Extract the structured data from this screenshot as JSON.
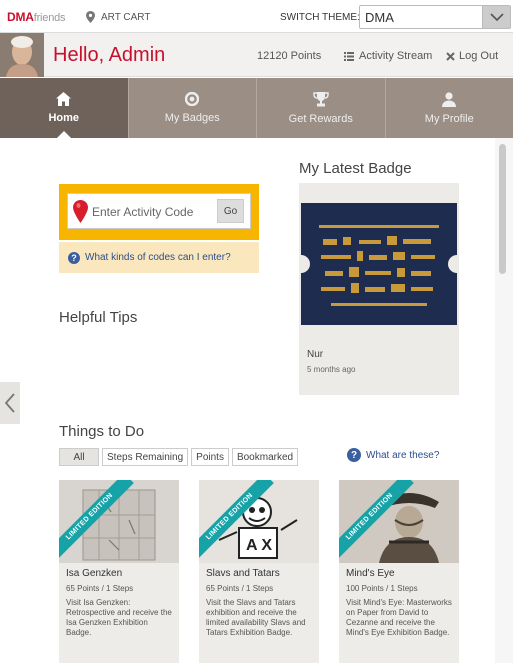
{
  "topbar": {
    "logo_dma": "DMA",
    "logo_friends": "friends",
    "art_cart": "ART CART",
    "switch_theme_label": "SWITCH THEME:",
    "theme_value": "DMA"
  },
  "header": {
    "greeting": "Hello, Admin",
    "points": "12120 Points",
    "activity_stream": "Activity Stream",
    "logout": "Log Out"
  },
  "nav": [
    {
      "label": "Home",
      "icon": "home-icon",
      "active": true
    },
    {
      "label": "My Badges",
      "icon": "badge-icon",
      "active": false
    },
    {
      "label": "Get Rewards",
      "icon": "trophy-icon",
      "active": false
    },
    {
      "label": "My Profile",
      "icon": "user-icon",
      "active": false
    }
  ],
  "activity_code": {
    "placeholder": "Enter Activity Code",
    "go_label": "Go",
    "help_link": "What kinds of codes can I enter?"
  },
  "helpful_tips": {
    "title": "Helpful Tips"
  },
  "latest_badge": {
    "title": "My Latest Badge",
    "name": "Nur",
    "time": "5 months ago"
  },
  "things_to_do": {
    "title": "Things to Do",
    "filters": [
      "All",
      "Steps Remaining",
      "Points",
      "Bookmarked"
    ],
    "help_link": "What are these?",
    "ribbon": "LIMITED EDITION",
    "cards": [
      {
        "title": "Isa Genzken",
        "meta": "65 Points / 1 Steps",
        "desc": "Visit Isa Genzken: Retrospective and receive the Isa Genzken Exhibition Badge."
      },
      {
        "title": "Slavs and Tatars",
        "meta": "65 Points / 1 Steps",
        "desc": "Visit the Slavs and Tatars exhibition and receive the limited availability Slavs and Tatars Exhibition Badge."
      },
      {
        "title": "Mind's Eye",
        "meta": "100 Points / 1 Steps",
        "desc": "Visit Mind's Eye: Masterworks on Paper from David to Cezanne and receive the Mind's Eye Exhibition Badge."
      }
    ]
  },
  "colors": {
    "brand_red": "#c8102e",
    "nav_active": "#6e625b",
    "nav_bg": "#9a8e85",
    "code_box": "#f7b500",
    "ribbon": "#16a3a8",
    "link_blue": "#2c4f8a"
  }
}
